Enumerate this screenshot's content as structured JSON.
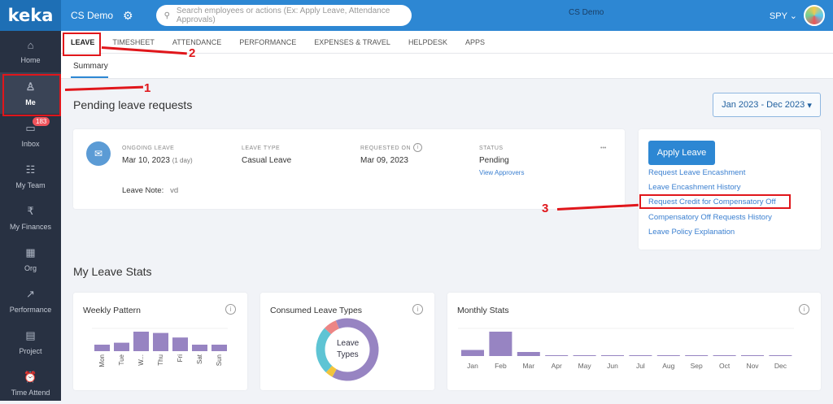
{
  "brand": {
    "logo": "keka"
  },
  "sidebar": {
    "items": [
      {
        "label": "Home",
        "icon": "home-icon",
        "glyph": "⌂"
      },
      {
        "label": "Me",
        "icon": "user-icon",
        "glyph": "♙"
      },
      {
        "label": "Inbox",
        "icon": "inbox-icon",
        "glyph": "▭",
        "badge": "183"
      },
      {
        "label": "My Team",
        "icon": "team-icon",
        "glyph": "☷"
      },
      {
        "label": "My Finances",
        "icon": "rupee-icon",
        "glyph": "₹"
      },
      {
        "label": "Org",
        "icon": "org-icon",
        "glyph": "▦"
      },
      {
        "label": "Performance",
        "icon": "trend-icon",
        "glyph": "↗"
      },
      {
        "label": "Project",
        "icon": "clipboard-icon",
        "glyph": "▤"
      },
      {
        "label": "Time Attend",
        "icon": "alarm-icon",
        "glyph": "⏰"
      }
    ]
  },
  "header": {
    "company": "CS Demo",
    "search_placeholder": "Search employees or actions (Ex: Apply Leave, Attendance Approvals)",
    "center_label": "CS Demo",
    "user": "SPY"
  },
  "tabs": [
    "LEAVE",
    "TIMESHEET",
    "ATTENDANCE",
    "PERFORMANCE",
    "EXPENSES & TRAVEL",
    "HELPDESK",
    "APPS"
  ],
  "subtab": "Summary",
  "pending": {
    "title": "Pending leave requests",
    "date_range": "Jan 2023 - Dec 2023",
    "ongoing_label": "ONGOING LEAVE",
    "ongoing_value": "Mar 10, 2023",
    "ongoing_days": "(1 day)",
    "type_label": "LEAVE TYPE",
    "type_value": "Casual Leave",
    "requested_label": "REQUESTED ON",
    "requested_value": "Mar 09, 2023",
    "status_label": "STATUS",
    "status_value": "Pending",
    "view_approvers": "View Approvers",
    "note_label": "Leave Note:",
    "note_value": "vd",
    "more": "•••"
  },
  "actions": {
    "apply": "Apply Leave",
    "links": [
      "Request Leave Encashment",
      "Leave Encashment History",
      "Request Credit for Compensatory Off",
      "Compensatory Off Requests History",
      "Leave Policy Explanation"
    ]
  },
  "stats": {
    "title": "My Leave Stats",
    "weekly_title": "Weekly Pattern",
    "consumed_title": "Consumed Leave Types",
    "donut_center_1": "Leave",
    "donut_center_2": "Types",
    "monthly_title": "Monthly Stats"
  },
  "annotations": [
    "1",
    "2",
    "3"
  ],
  "colors": {
    "accent": "#2d87d3",
    "bar": "#9784c2",
    "sidebar": "#283142",
    "annotation": "#e0161b"
  },
  "chart_data": [
    {
      "type": "bar",
      "title": "Weekly Pattern",
      "categories": [
        "Mon",
        "Tue",
        "W...",
        "Thu",
        "Fri",
        "Sat",
        "Sun"
      ],
      "values": [
        1,
        1.3,
        3,
        2.8,
        2.1,
        1,
        1
      ]
    },
    {
      "type": "pie",
      "title": "Consumed Leave Types",
      "slices": [
        {
          "value": 58,
          "color": "#9784c2"
        },
        {
          "value": 4,
          "color": "#f2c43c"
        },
        {
          "value": 25,
          "color": "#5ec4d4"
        },
        {
          "value": 7,
          "color": "#ec8585"
        },
        {
          "value": 6,
          "color": "#9784c2"
        }
      ]
    },
    {
      "type": "bar",
      "title": "Monthly Stats",
      "categories": [
        "Jan",
        "Feb",
        "Mar",
        "Apr",
        "May",
        "Jun",
        "Jul",
        "Aug",
        "Sep",
        "Oct",
        "Nov",
        "Dec"
      ],
      "values": [
        1.5,
        6,
        1,
        0,
        0,
        0,
        0,
        0,
        0,
        0,
        0,
        0
      ]
    }
  ]
}
